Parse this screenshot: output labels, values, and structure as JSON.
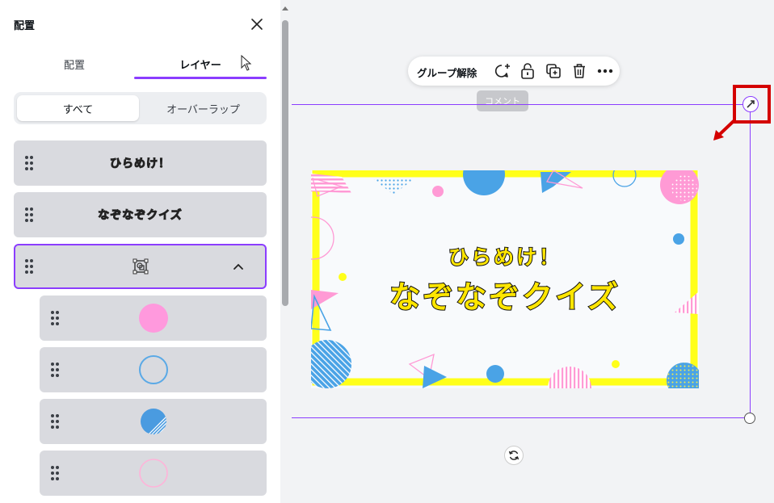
{
  "panel": {
    "title": "配置",
    "tabs": [
      {
        "label": "配置"
      },
      {
        "label": "レイヤー"
      }
    ],
    "segment": {
      "options": [
        "すべて",
        "オーバーラップ"
      ],
      "selected": "すべて"
    },
    "layers": [
      {
        "type": "text",
        "preview": "ひらめけ！"
      },
      {
        "type": "text",
        "preview": "なぞなぞクイズ"
      },
      {
        "type": "group",
        "icon": "group-icon",
        "expanded": true
      },
      {
        "type": "shape",
        "icon": "pink-circle-icon",
        "color": "#ff99dd"
      },
      {
        "type": "shape",
        "icon": "blue-ring-icon",
        "color": "#5aa9e6"
      },
      {
        "type": "shape",
        "icon": "blue-striped-circle-icon",
        "color": "#4a9be0"
      },
      {
        "type": "shape",
        "icon": "pink-ring-icon",
        "color": "#ffb3d9"
      }
    ]
  },
  "toolbar": {
    "ungroup_label": "グループ解除",
    "icons": [
      "comment-add-icon",
      "lock-icon",
      "duplicate-icon",
      "trash-icon",
      "more-icon"
    ]
  },
  "tooltip": "コメント",
  "slide": {
    "line1": "ひらめけ！",
    "line2": "なぞなぞクイズ"
  },
  "colors": {
    "accent": "#8b3dff",
    "highlight": "#d40000",
    "frame_yellow": "#ffff1a",
    "pink": "#ff9ad5",
    "blue": "#4aa3e6"
  }
}
